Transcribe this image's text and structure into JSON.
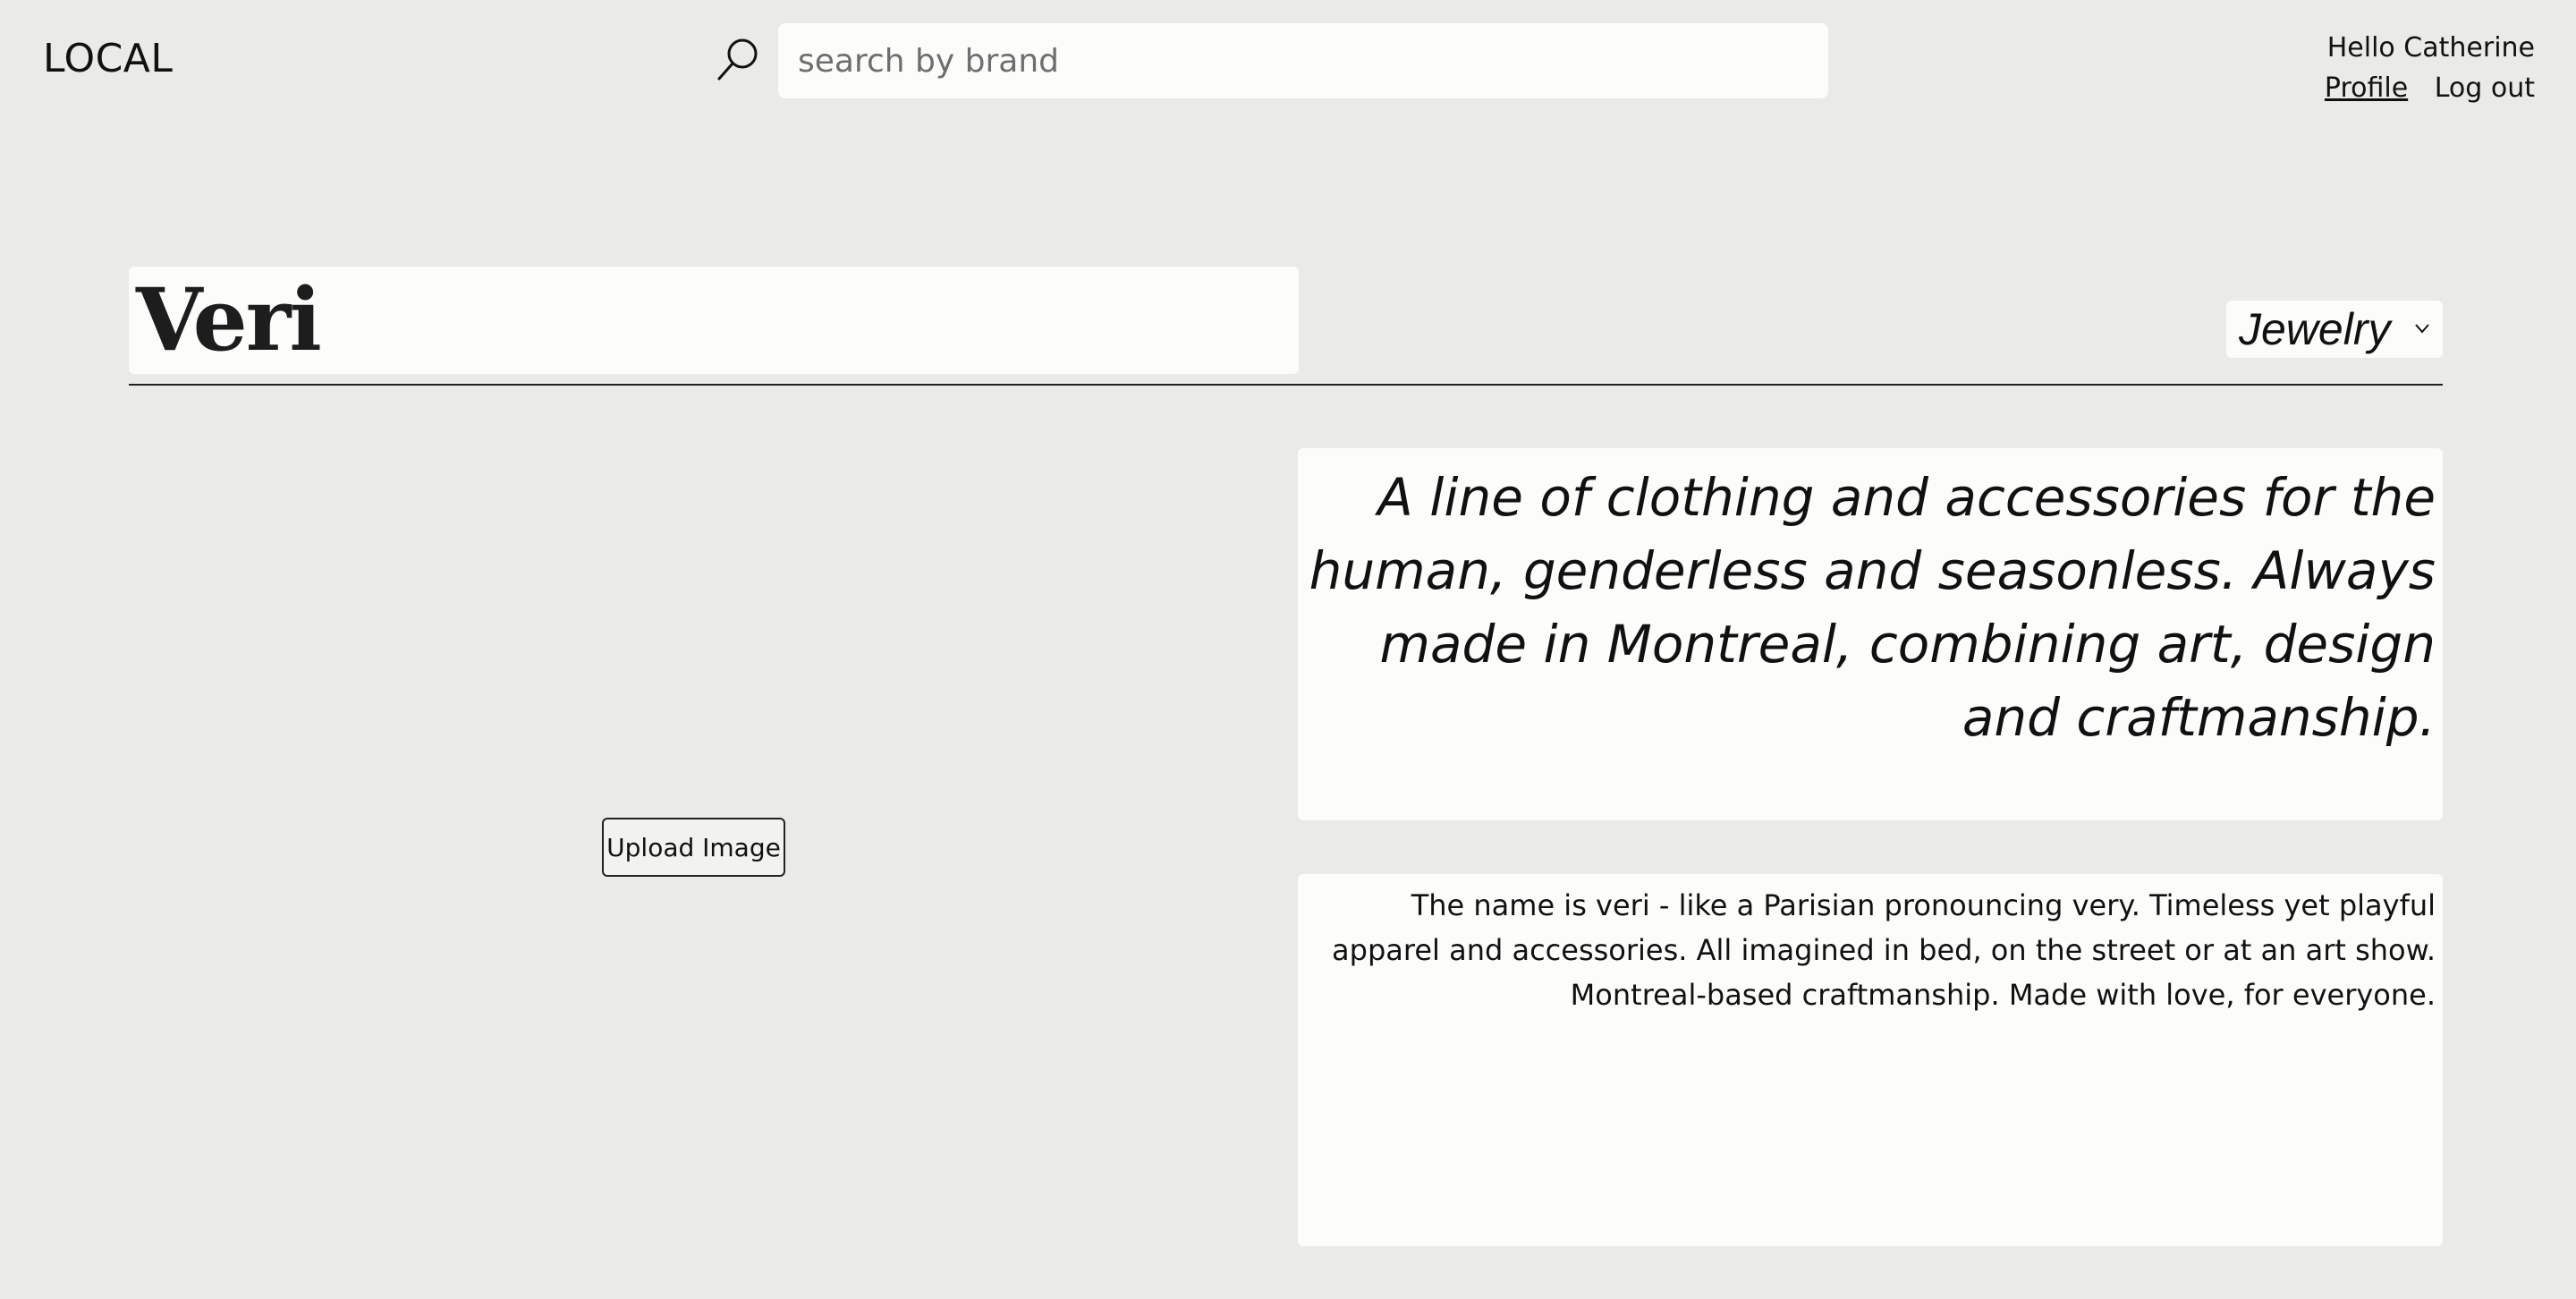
{
  "header": {
    "logo": "LOCAL",
    "search": {
      "placeholder": "search by brand",
      "value": "",
      "icon": "search-icon"
    },
    "user": {
      "greeting": "Hello Catherine",
      "profile_label": "Profile",
      "logout_label": "Log out"
    }
  },
  "brand": {
    "name": "Veri",
    "category": {
      "selected": "Jewelry",
      "icon": "chevron-down-icon"
    },
    "upload_button_label": "Upload Image",
    "tagline": "A line of clothing and accessories for the human, genderless and seasonless. Always made in Montreal, combining art, design and craftmanship.",
    "description": "The name is veri - like a Parisian pronouncing very. Timeless yet playful apparel and accessories. All imagined in bed, on the street or at an art show. Montreal-based craftmanship. Made with love, for everyone."
  },
  "colors": {
    "background": "#eaeae6",
    "panel": "#fcfcfa",
    "text": "#111111"
  }
}
